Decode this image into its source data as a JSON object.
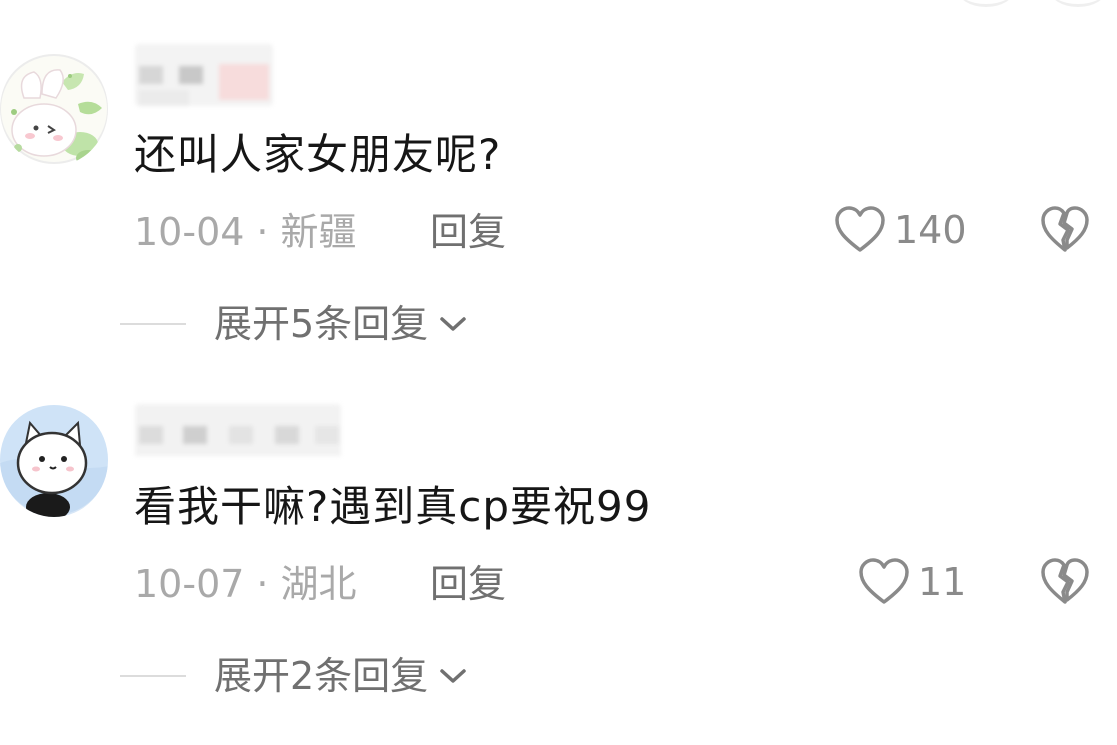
{
  "comments": [
    {
      "text": "还叫人家女朋友呢?",
      "date": "10-04",
      "location": "新疆",
      "reply_label": "回复",
      "likes": "140",
      "expand_label": "展开5条回复",
      "avatar_icon": "bunny-with-leaves-avatar"
    },
    {
      "text": "看我干嘛?遇到真cp要祝99",
      "date": "10-07",
      "location": "湖北",
      "reply_label": "回复",
      "likes": "11",
      "expand_label": "展开2条回复",
      "avatar_icon": "white-cat-avatar"
    }
  ],
  "meta_separator": "·",
  "colors": {
    "text_primary": "#161616",
    "text_meta": "#a9a9a9",
    "text_secondary": "#707070",
    "icon_stroke": "#8a8a8a"
  }
}
